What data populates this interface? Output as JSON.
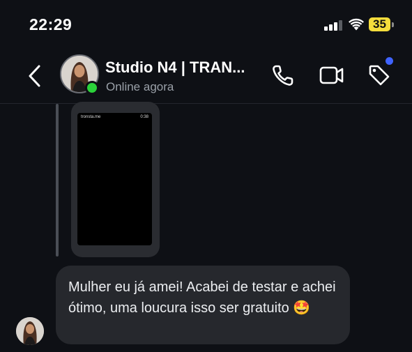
{
  "status_bar": {
    "time": "22:29",
    "battery_level": "35",
    "signal_bars": 3,
    "wifi": true
  },
  "header": {
    "back_icon": "chevron-left-icon",
    "contact_name": "Studio N4 | TRAN...",
    "status": "Online agora",
    "online": true,
    "call_icon": "phone-icon",
    "video_icon": "video-icon",
    "tag_icon": "tag-icon",
    "tag_badge_color": "#3f63ff"
  },
  "messages": [
    {
      "type": "media",
      "media_status_left": "tronsta.me",
      "media_status_right": "0:38"
    },
    {
      "type": "text",
      "text": "Mulher eu já amei! Acabei de testar e achei ótimo, uma loucura isso ser gratuito 🤩"
    }
  ],
  "colors": {
    "background": "#0e1015",
    "bubble": "#26282d",
    "online_green": "#2bd23a",
    "battery_yellow": "#f5dd3c"
  }
}
